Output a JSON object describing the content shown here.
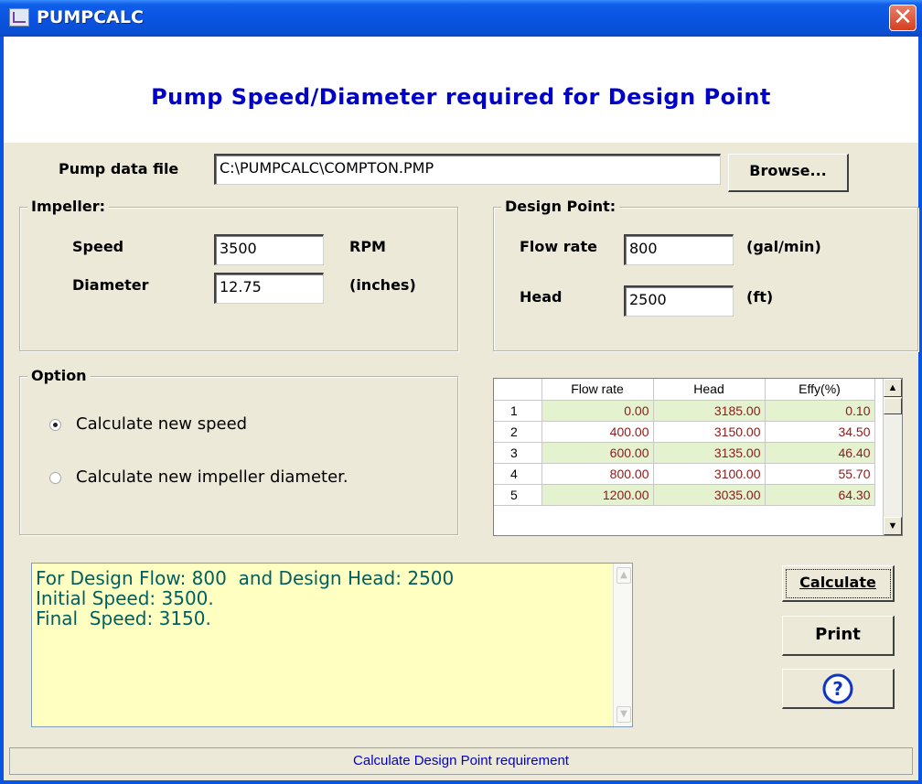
{
  "window": {
    "title": "PUMPCALC",
    "close_glyph": "✕"
  },
  "heading": "Pump Speed/Diameter required for Design Point",
  "pump_file": {
    "label": "Pump data file",
    "value": "C:\\PUMPCALC\\COMPTON.PMP",
    "browse_label": "Browse..."
  },
  "impeller": {
    "title": "Impeller:",
    "speed_label": "Speed",
    "speed_value": "3500",
    "speed_unit": "RPM",
    "diameter_label": "Diameter",
    "diameter_value": "12.75",
    "diameter_unit": "(inches)"
  },
  "design_point": {
    "title": "Design Point:",
    "flow_label": "Flow rate",
    "flow_value": "800",
    "flow_unit": "(gal/min)",
    "head_label": "Head",
    "head_value": "2500",
    "head_unit": "(ft)"
  },
  "option": {
    "title": "Option",
    "choices": [
      {
        "label": "Calculate new speed",
        "selected": true
      },
      {
        "label": "Calculate new impeller diameter.",
        "selected": false
      }
    ]
  },
  "grid": {
    "columns": [
      "",
      "Flow rate",
      "Head",
      "Effy(%)"
    ],
    "rows": [
      [
        "1",
        "0.00",
        "3185.00",
        "0.10"
      ],
      [
        "2",
        "400.00",
        "3150.00",
        "34.50"
      ],
      [
        "3",
        "600.00",
        "3135.00",
        "46.40"
      ],
      [
        "4",
        "800.00",
        "3100.00",
        "55.70"
      ],
      [
        "5",
        "1200.00",
        "3035.00",
        "64.30"
      ]
    ]
  },
  "output_lines": [
    "For Design Flow: 800  and Design Head: 2500",
    "Initial Speed: 3500.",
    "Final  Speed: 3150."
  ],
  "buttons": {
    "calculate": "Calculate",
    "print": "Print",
    "help_icon": "question-circle-icon"
  },
  "status": "Calculate Design Point requirement"
}
